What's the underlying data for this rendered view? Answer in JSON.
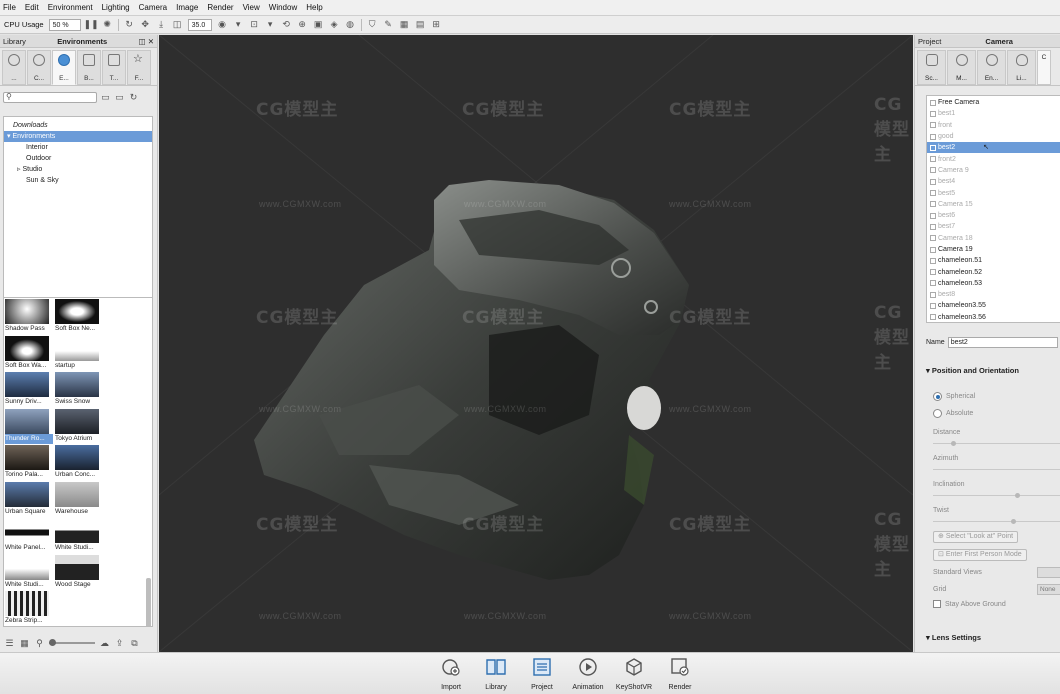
{
  "menu": [
    "File",
    "Edit",
    "Environment",
    "Lighting",
    "Camera",
    "Image",
    "Render",
    "View",
    "Window",
    "Help"
  ],
  "toolbar": {
    "cpu_label": "CPU Usage",
    "cpu_value": "50 %",
    "focal_value": "35.0"
  },
  "library": {
    "title": "Library",
    "section": "Environments",
    "tabs": [
      "...",
      "C...",
      "E...",
      "B...",
      "T...",
      "F..."
    ],
    "tree": {
      "downloads": "Downloads",
      "environments": "Environments",
      "interior": "Interior",
      "outdoor": "Outdoor",
      "studio": "Studio",
      "sunsky": "Sun & Sky"
    },
    "thumbnails": [
      "Shadow Pass",
      "Soft Box Ne...",
      "Soft Box Wa...",
      "startup",
      "Sunny Driv...",
      "Swiss Snow",
      "Thunder Ro...",
      "Tokyo Atrium",
      "Torino Pala...",
      "Urban Conc...",
      "Urban Square",
      "Warehouse",
      "White Panel...",
      "White Studi...",
      "White Studi...",
      "Wood Stage",
      "Zebra Strip..."
    ]
  },
  "watermark": {
    "brand": "CG模型主",
    "url": "www.CGMXW.com"
  },
  "project": {
    "title": "Project",
    "section": "Camera",
    "tabs": [
      "Sc...",
      "M...",
      "En...",
      "Li...",
      "C"
    ],
    "cameras": [
      "Free Camera",
      "best1",
      "front",
      "good",
      "best2",
      "front2",
      "Camera 9",
      "best4",
      "best5",
      "Camera 15",
      "best6",
      "best7",
      "Camera 18",
      "Camera 19",
      "chameleon.51",
      "chameleon.52",
      "chameleon.53",
      "best8",
      "chameleon3.55",
      "chameleon3.56"
    ],
    "name_label": "Name",
    "name_value": "best2",
    "position_title": "Position and Orientation",
    "spherical": "Spherical",
    "absolute": "Absolute",
    "distance": "Distance",
    "azimuth": "Azimuth",
    "inclination": "Inclination",
    "twist": "Twist",
    "select_lookat": "Select \"Look at\" Point",
    "first_person": "Enter First Person Mode",
    "standard_views": "Standard Views",
    "grid": "Grid",
    "grid_value": "None",
    "stay_above": "Stay Above Ground",
    "lens_title": "Lens Settings"
  },
  "dock": [
    "Import",
    "Library",
    "Project",
    "Animation",
    "KeyShotVR",
    "Render"
  ],
  "colors": {
    "selection": "#6b9bd8",
    "viewport_bg": "#2e2e2e",
    "model": "#3c3f3c"
  }
}
